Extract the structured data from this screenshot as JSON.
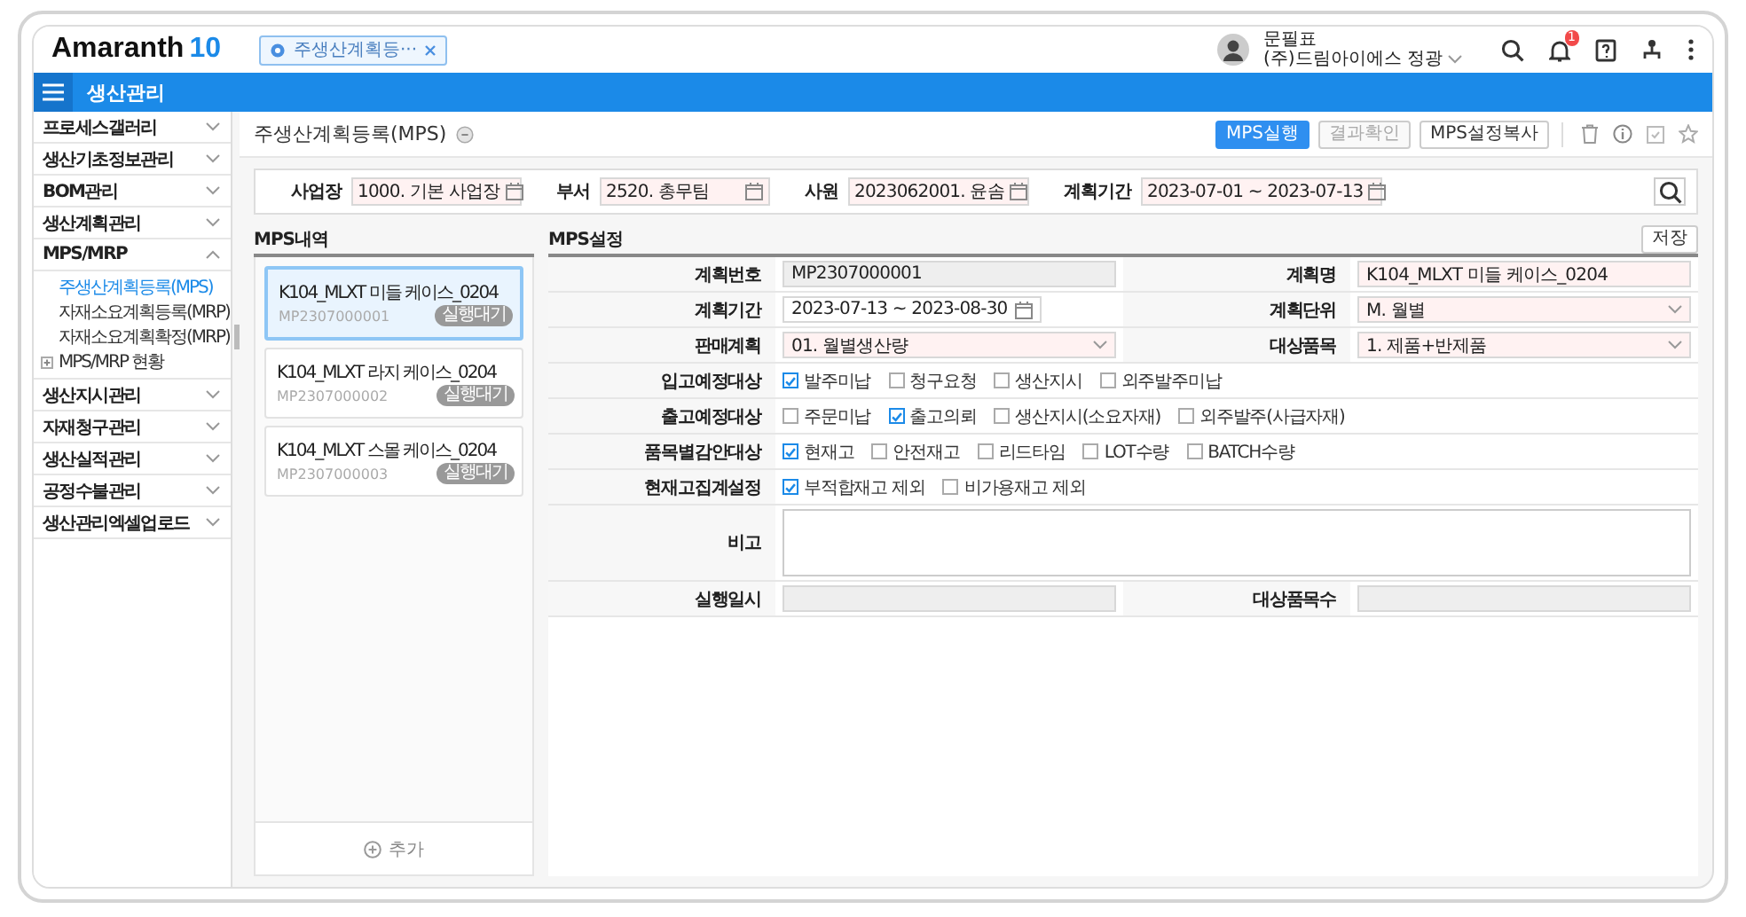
{
  "header": {
    "logo": "Amaranth",
    "logo_version": "10",
    "tabs": [
      {
        "label": "주생산계획등···",
        "selected": true
      }
    ],
    "user": {
      "name": "문필표",
      "company": "(주)드림아이에스 정광"
    },
    "notification_count": "1"
  },
  "module_bar": {
    "title": "생산관리"
  },
  "sidebar": {
    "items": [
      {
        "label": "프로세스갤러리",
        "expanded": false
      },
      {
        "label": "생산기초정보관리",
        "expanded": false
      },
      {
        "label": "BOM관리",
        "expanded": false
      },
      {
        "label": "생산계획관리",
        "expanded": false
      },
      {
        "label": "MPS/MRP",
        "expanded": true,
        "children": [
          {
            "label": "주생산계획등록(MPS)",
            "kind": "page",
            "selected": true
          },
          {
            "label": "자재소요계획등록(MRP)",
            "kind": "page",
            "selected": false
          },
          {
            "label": "자재소요계획확정(MRP)",
            "kind": "page",
            "selected": false
          },
          {
            "label": "MPS/MRP 현황",
            "kind": "folder",
            "selected": false
          }
        ]
      },
      {
        "label": "생산지시관리",
        "expanded": false
      },
      {
        "label": "자재청구관리",
        "expanded": false
      },
      {
        "label": "생산실적관리",
        "expanded": false
      },
      {
        "label": "공정수불관리",
        "expanded": false
      },
      {
        "label": "생산관리엑셀업로드",
        "expanded": false
      }
    ]
  },
  "page": {
    "title": "주생산계획등록(MPS)",
    "buttons": [
      {
        "label": "MPS실행",
        "kind": "primary",
        "disabled": false
      },
      {
        "label": "결과확인",
        "kind": "normal",
        "disabled": true
      },
      {
        "label": "MPS설정복사",
        "kind": "normal",
        "disabled": false
      }
    ]
  },
  "filters": [
    {
      "label": "사업장",
      "value": "1000. 기본 사업장"
    },
    {
      "label": "부서",
      "value": "2520. 총무팀"
    },
    {
      "label": "사원",
      "value": "2023062001. 윤솜"
    },
    {
      "label": "계획기간",
      "value": "2023-07-01 ~ 2023-07-13"
    }
  ],
  "mps_list": {
    "title": "MPS내역",
    "items": [
      {
        "name": "K104_MLXT 미들 케이스_0204",
        "code": "MP2307000001",
        "status": "실행대기",
        "selected": true
      },
      {
        "name": "K104_MLXT 라지 케이스_0204",
        "code": "MP2307000002",
        "status": "실행대기",
        "selected": false
      },
      {
        "name": "K104_MLXT 스몰 케이스_0204",
        "code": "MP2307000003",
        "status": "실행대기",
        "selected": false
      }
    ],
    "add_button": "추가"
  },
  "mps_settings": {
    "title": "MPS설정",
    "save_button": "저장",
    "rows": [
      {
        "kind": "pair",
        "fields": [
          {
            "label": "계획번호",
            "kind": "readonly",
            "value": "MP2307000001",
            "required": false
          },
          {
            "label": "계획명",
            "kind": "text",
            "value": "K104_MLXT 미들 케이스_0204",
            "required": true
          }
        ]
      },
      {
        "kind": "pair",
        "fields": [
          {
            "label": "계획기간",
            "kind": "date",
            "value": "2023-07-13 ~ 2023-08-30",
            "required": false
          },
          {
            "label": "계획단위",
            "kind": "select",
            "value": "M. 월별",
            "required": true
          }
        ]
      },
      {
        "kind": "pair",
        "fields": [
          {
            "label": "판매계획",
            "kind": "select",
            "value": "01. 월별생산량",
            "required": true
          },
          {
            "label": "대상품목",
            "kind": "select",
            "value": "1. 제품+반제품",
            "required": true
          }
        ]
      },
      {
        "kind": "checks",
        "label": "입고예정대상",
        "options": [
          {
            "label": "발주미납",
            "checked": true
          },
          {
            "label": "청구요청",
            "checked": false
          },
          {
            "label": "생산지시",
            "checked": false
          },
          {
            "label": "외주발주미납",
            "checked": false
          }
        ]
      },
      {
        "kind": "checks",
        "label": "출고예정대상",
        "options": [
          {
            "label": "주문미납",
            "checked": false
          },
          {
            "label": "출고의뢰",
            "checked": true
          },
          {
            "label": "생산지시(소요자재)",
            "checked": false
          },
          {
            "label": "외주발주(사급자재)",
            "checked": false
          }
        ]
      },
      {
        "kind": "checks",
        "label": "품목별감안대상",
        "options": [
          {
            "label": "현재고",
            "checked": true
          },
          {
            "label": "안전재고",
            "checked": false
          },
          {
            "label": "리드타임",
            "checked": false
          },
          {
            "label": "LOT수량",
            "checked": false
          },
          {
            "label": "BATCH수량",
            "checked": false
          }
        ]
      },
      {
        "kind": "checks",
        "label": "현재고집계설정",
        "options": [
          {
            "label": "부적합재고 제외",
            "checked": true
          },
          {
            "label": "비가용재고 제외",
            "checked": false
          }
        ]
      },
      {
        "kind": "textarea",
        "label": "비고"
      },
      {
        "kind": "pair",
        "fields": [
          {
            "label": "실행일시",
            "kind": "readonly",
            "required": false
          },
          {
            "label": "대상품목수",
            "kind": "readonly",
            "required": false
          }
        ]
      }
    ]
  }
}
